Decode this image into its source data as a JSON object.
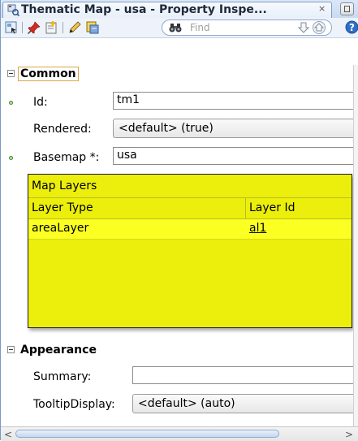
{
  "window": {
    "tab_title": "Thematic Map - usa - Property Inspe...",
    "close_glyph": "×"
  },
  "toolbar": {
    "find_placeholder": "Find"
  },
  "sections": {
    "common": {
      "title": "Common",
      "id_label": "Id:",
      "id_value": "tm1",
      "rendered_label": "Rendered:",
      "rendered_value": "<default> (true)",
      "basemap_label": "Basemap *:",
      "basemap_value": "usa"
    },
    "appearance": {
      "title": "Appearance",
      "summary_label": "Summary:",
      "summary_value": "",
      "tooltip_label": "TooltipDisplay:",
      "tooltip_value": "<default> (auto)"
    }
  },
  "map_layers": {
    "title": "Map Layers",
    "columns": [
      "Layer Type",
      "Layer Id"
    ],
    "rows": [
      {
        "type": "areaLayer",
        "id": "al1"
      }
    ]
  },
  "scrollbar": {
    "left_glyph": "<",
    "right_glyph": ">"
  },
  "colors": {
    "popup_background": "#ecef0b",
    "selected_row": "#fbff22",
    "focus_border": "#d9a64a"
  }
}
